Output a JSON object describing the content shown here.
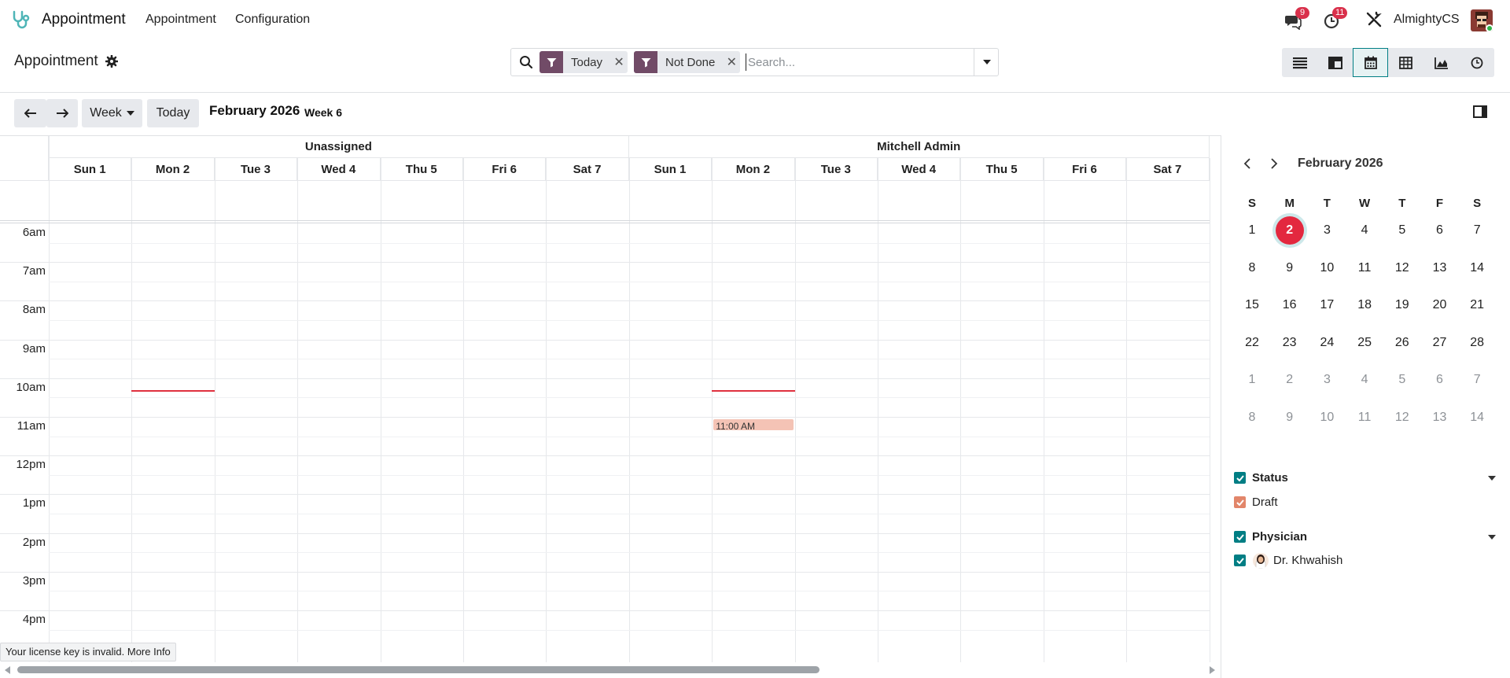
{
  "nav": {
    "app_name": "Appointment",
    "menu": [
      "Appointment",
      "Configuration"
    ],
    "messages_count": "9",
    "activities_count": "11",
    "username": "AlmightyCS"
  },
  "control": {
    "title": "Appointment",
    "facets": [
      {
        "label": "Today"
      },
      {
        "label": "Not Done"
      }
    ],
    "search_placeholder": "Search..."
  },
  "views": [
    "list-icon",
    "kanban-icon",
    "calendar-icon",
    "pivot-icon",
    "graph-icon",
    "activity-icon"
  ],
  "toolbar": {
    "prev": "←",
    "next": "→",
    "scale": "Week",
    "today": "Today",
    "month": "February 2026",
    "week": "Week 6"
  },
  "calendar": {
    "groups": [
      "Unassigned",
      "Mitchell Admin"
    ],
    "days": [
      "Sun 1",
      "Mon 2",
      "Tue 3",
      "Wed 4",
      "Thu 5",
      "Fri 6",
      "Sat 7"
    ],
    "hours": [
      "6am",
      "7am",
      "8am",
      "9am",
      "10am",
      "11am",
      "12pm",
      "1pm",
      "2pm",
      "3pm",
      "4pm"
    ],
    "event": {
      "label": "11:00 AM"
    }
  },
  "license": "Your license key is invalid. More Info",
  "mini_calendar": {
    "title": "February 2026",
    "weekday_headers": [
      "S",
      "M",
      "T",
      "W",
      "T",
      "F",
      "S"
    ],
    "weeks": [
      [
        "1",
        "2",
        "3",
        "4",
        "5",
        "6",
        "7"
      ],
      [
        "8",
        "9",
        "10",
        "11",
        "12",
        "13",
        "14"
      ],
      [
        "15",
        "16",
        "17",
        "18",
        "19",
        "20",
        "21"
      ],
      [
        "22",
        "23",
        "24",
        "25",
        "26",
        "27",
        "28"
      ],
      [
        "1",
        "2",
        "3",
        "4",
        "5",
        "6",
        "7"
      ],
      [
        "8",
        "9",
        "10",
        "11",
        "12",
        "13",
        "14"
      ]
    ],
    "today": "2"
  },
  "filters": {
    "status": {
      "title": "Status",
      "items": [
        "Draft"
      ]
    },
    "physician": {
      "title": "Physician",
      "items": [
        "Dr. Khwahish"
      ]
    }
  },
  "colors": {
    "brand": "#714b67",
    "accent": "#017e84",
    "today": "#e3283f",
    "event": "#f4c3b5",
    "draft": "#e2866a"
  }
}
